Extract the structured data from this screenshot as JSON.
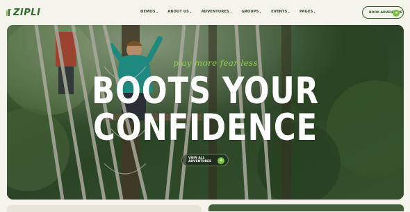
{
  "brand": {
    "logo_text": "ZIPLI",
    "accent": "#7bc043",
    "dark_green": "#2f5a2a"
  },
  "nav": {
    "items": [
      {
        "label": "DEMOS"
      },
      {
        "label": "ABOUT US"
      },
      {
        "label": "ADVENTURES"
      },
      {
        "label": "GROUPS"
      },
      {
        "label": "EVENTS"
      },
      {
        "label": "PAGES"
      }
    ]
  },
  "header": {
    "cta_label": "BOOK ADVENTURE",
    "cta_icon": "arrow-right-icon"
  },
  "hero": {
    "script_text": "play more fear less",
    "headline_line1": "BOOTS YOUR",
    "headline_line2": "CONFIDENCE",
    "cta_label": "VIEW ALL ADVENTURES",
    "cta_icon": "arrow-right-icon"
  }
}
